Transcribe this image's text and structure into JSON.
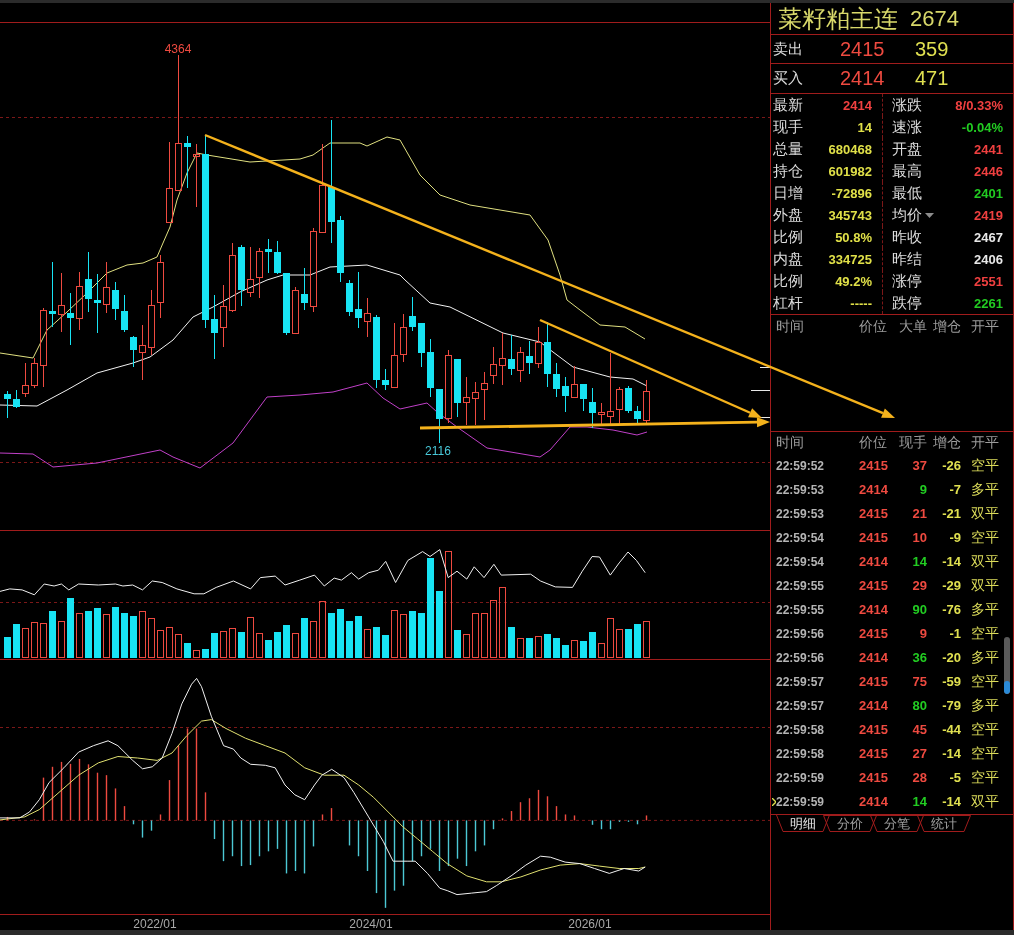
{
  "chart": {
    "high_label": "4364",
    "low_label": "2116",
    "date_labels": [
      "2022/01",
      "2024/01",
      "2026/01"
    ]
  },
  "quote": {
    "name": "菜籽粕主连",
    "number": "2674",
    "ask": {
      "label": "卖出",
      "price": "2415",
      "volume": "359"
    },
    "bid": {
      "label": "买入",
      "price": "2414",
      "volume": "471"
    }
  },
  "stats": [
    {
      "label": "最新",
      "value": "2414",
      "color": "#f04040",
      "kind": "plain"
    },
    {
      "label": "涨跌",
      "value": "8/0.33%",
      "color": "#f04040",
      "kind": "plain"
    },
    {
      "label": "现手",
      "value": "14",
      "color": "#e0e048",
      "kind": "plain"
    },
    {
      "label": "速涨",
      "value": "-0.04%",
      "color": "#22cc22",
      "kind": "plain"
    },
    {
      "label": "总量",
      "value": "680468",
      "color": "#e0e048",
      "kind": "plain"
    },
    {
      "label": "开盘",
      "value": "2441",
      "color": "#f04040",
      "kind": "plain"
    },
    {
      "label": "持仓",
      "value": "601982",
      "color": "#e0e048",
      "kind": "plain"
    },
    {
      "label": "最高",
      "value": "2446",
      "color": "#f04040",
      "kind": "plain"
    },
    {
      "label": "日增",
      "value": "-72896",
      "color": "#e0e048",
      "kind": "plain"
    },
    {
      "label": "最低",
      "value": "2401",
      "color": "#22cc22",
      "kind": "plain"
    },
    {
      "label": "外盘",
      "value": "345743",
      "color": "#e0e048",
      "kind": "plain"
    },
    {
      "label": "均价",
      "value": "2419",
      "color": "#f04040",
      "kind": "dropdown"
    },
    {
      "label": "比例",
      "value": "50.8%",
      "color": "#e0e048",
      "kind": "plain"
    },
    {
      "label": "昨收",
      "value": "2467",
      "color": "#e8e8e8",
      "kind": "plain"
    },
    {
      "label": "内盘",
      "value": "334725",
      "color": "#e0e048",
      "kind": "plain"
    },
    {
      "label": "昨结",
      "value": "2406",
      "color": "#e8e8e8",
      "kind": "plain"
    },
    {
      "label": "比例",
      "value": "49.2%",
      "color": "#e0e048",
      "kind": "plain"
    },
    {
      "label": "涨停",
      "value": "2551",
      "color": "#f04040",
      "kind": "plain"
    },
    {
      "label": "杠杆",
      "value": "-----",
      "color": "#e0e048",
      "kind": "plain"
    },
    {
      "label": "跌停",
      "value": "2261",
      "color": "#22cc22",
      "kind": "plain"
    }
  ],
  "big_orders": {
    "columns": [
      "时间",
      "价位",
      "大单",
      "增仓",
      "开平"
    ]
  },
  "trades": {
    "columns": [
      "时间",
      "价位",
      "现手",
      "增仓",
      "开平"
    ],
    "rows": [
      {
        "time": "22:59:52",
        "price": "2415",
        "volume": "37",
        "color": "#ee4a40",
        "change": "-26",
        "type": "空平",
        "selected": false
      },
      {
        "time": "22:59:53",
        "price": "2414",
        "volume": "9",
        "color": "#22cc22",
        "change": "-7",
        "type": "多平",
        "selected": false
      },
      {
        "time": "22:59:53",
        "price": "2415",
        "volume": "21",
        "color": "#ee4a40",
        "change": "-21",
        "type": "双平",
        "selected": false
      },
      {
        "time": "22:59:54",
        "price": "2415",
        "volume": "10",
        "color": "#ee4a40",
        "change": "-9",
        "type": "空平",
        "selected": false
      },
      {
        "time": "22:59:54",
        "price": "2414",
        "volume": "14",
        "color": "#22cc22",
        "change": "-14",
        "type": "双平",
        "selected": false
      },
      {
        "time": "22:59:55",
        "price": "2415",
        "volume": "29",
        "color": "#ee4a40",
        "change": "-29",
        "type": "双平",
        "selected": false
      },
      {
        "time": "22:59:55",
        "price": "2414",
        "volume": "90",
        "color": "#22cc22",
        "change": "-76",
        "type": "多平",
        "selected": false
      },
      {
        "time": "22:59:56",
        "price": "2415",
        "volume": "9",
        "color": "#ee4a40",
        "change": "-1",
        "type": "空平",
        "selected": false
      },
      {
        "time": "22:59:56",
        "price": "2414",
        "volume": "36",
        "color": "#22cc22",
        "change": "-20",
        "type": "多平",
        "selected": false
      },
      {
        "time": "22:59:57",
        "price": "2415",
        "volume": "75",
        "color": "#ee4a40",
        "change": "-59",
        "type": "空平",
        "selected": false
      },
      {
        "time": "22:59:57",
        "price": "2414",
        "volume": "80",
        "color": "#22cc22",
        "change": "-79",
        "type": "多平",
        "selected": false
      },
      {
        "time": "22:59:58",
        "price": "2415",
        "volume": "45",
        "color": "#ee4a40",
        "change": "-44",
        "type": "空平",
        "selected": false
      },
      {
        "time": "22:59:58",
        "price": "2415",
        "volume": "27",
        "color": "#ee4a40",
        "change": "-14",
        "type": "空平",
        "selected": false
      },
      {
        "time": "22:59:59",
        "price": "2415",
        "volume": "28",
        "color": "#ee4a40",
        "change": "-5",
        "type": "空平",
        "selected": false
      },
      {
        "time": "22:59:59",
        "price": "2414",
        "volume": "14",
        "color": "#22cc22",
        "change": "-14",
        "type": "双平",
        "selected": true
      }
    ]
  },
  "tabs": [
    {
      "label": "明细",
      "selected": true
    },
    {
      "label": "分价",
      "selected": false
    },
    {
      "label": "分笔",
      "selected": false
    },
    {
      "label": "统计",
      "selected": false
    }
  ]
}
